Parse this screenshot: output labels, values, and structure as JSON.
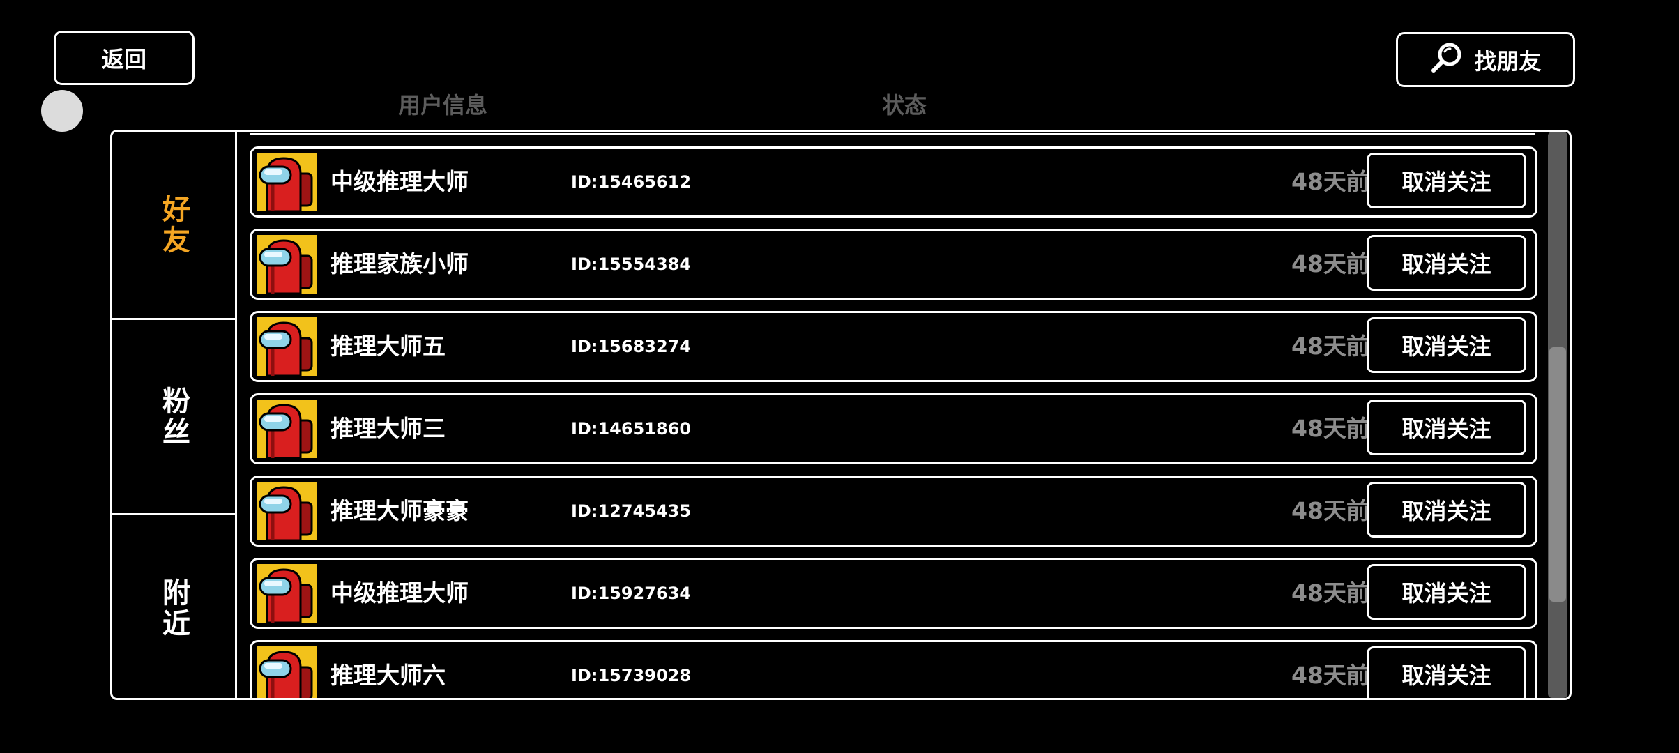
{
  "header": {
    "back_label": "返回",
    "find_friends_label": "找朋友",
    "col_user_info": "用户信息",
    "col_status": "状态"
  },
  "tabs": [
    {
      "label": "好友",
      "active": true
    },
    {
      "label": "粉丝",
      "active": false
    },
    {
      "label": "附近",
      "active": false
    }
  ],
  "rows": [
    {
      "name": "中级推理大师",
      "id": "ID:15465612",
      "status": "48天前",
      "action": "取消关注"
    },
    {
      "name": "推理家族小师",
      "id": "ID:15554384",
      "status": "48天前",
      "action": "取消关注"
    },
    {
      "name": "推理大师五",
      "id": "ID:15683274",
      "status": "48天前",
      "action": "取消关注"
    },
    {
      "name": "推理大师三",
      "id": "ID:14651860",
      "status": "48天前",
      "action": "取消关注"
    },
    {
      "name": "推理大师豪豪",
      "id": "ID:12745435",
      "status": "48天前",
      "action": "取消关注"
    },
    {
      "name": "中级推理大师",
      "id": "ID:15927634",
      "status": "48天前",
      "action": "取消关注"
    },
    {
      "name": "推理大师六",
      "id": "ID:15739028",
      "status": "48天前",
      "action": "取消关注"
    }
  ],
  "colors": {
    "background": "#000000",
    "active_tab": "#f5a623",
    "status_text": "#8c8c8c",
    "header_text": "#5c5c5c",
    "avatar_bg": "#f2c21b",
    "crewmate_red": "#d91f1f"
  },
  "icons": {
    "find": "search-icon",
    "avatar": "crewmate-avatar-icon"
  },
  "scroll": {
    "thumb_start": 0.38,
    "thumb_end": 0.83
  }
}
